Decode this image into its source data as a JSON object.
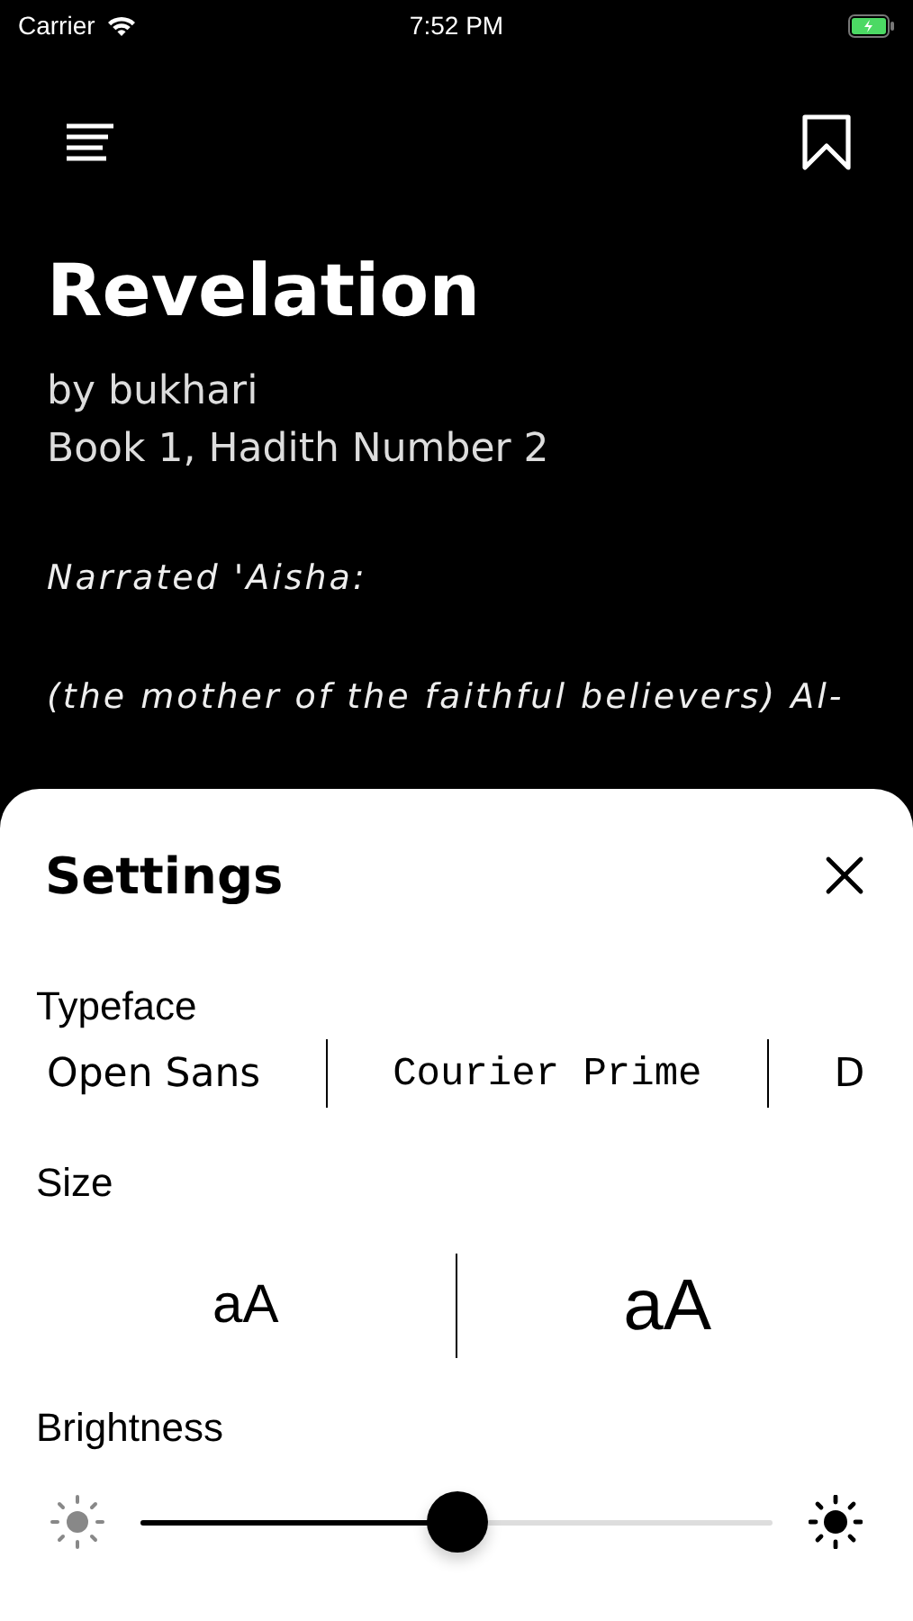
{
  "status_bar": {
    "carrier": "Carrier",
    "time": "7:52 PM"
  },
  "reader": {
    "title": "Revelation",
    "author": "by bukhari",
    "reference": "Book 1, Hadith Number 2",
    "paragraphs": [
      "Narrated 'Aisha:",
      "(the mother of the faithful believers) Al-"
    ]
  },
  "settings": {
    "title": "Settings",
    "typeface_label": "Typeface",
    "typefaces": [
      {
        "label": "Open Sans",
        "kind": "sans"
      },
      {
        "label": "Courier Prime",
        "kind": "mono"
      },
      {
        "label": "D",
        "kind": "sans"
      }
    ],
    "size_label": "Size",
    "sizes": [
      {
        "label": "aA",
        "kind": "smaller"
      },
      {
        "label": "aA",
        "kind": "larger"
      }
    ],
    "brightness_label": "Brightness",
    "brightness": {
      "level": 0.5
    }
  }
}
